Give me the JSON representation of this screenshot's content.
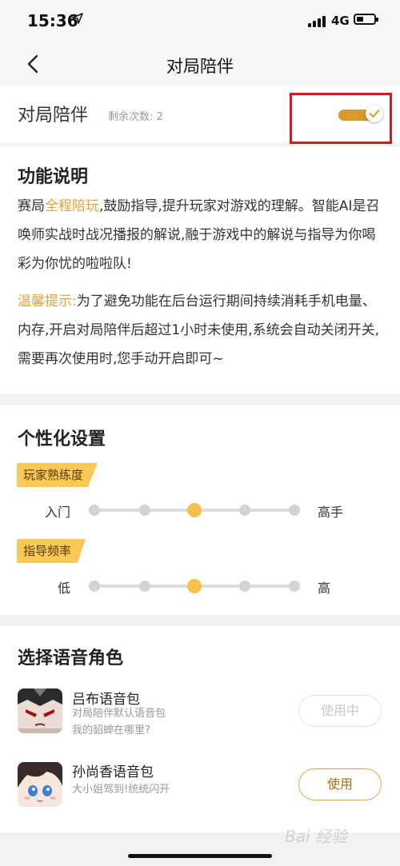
{
  "status_bar": {
    "time": "15:36",
    "network": "4G",
    "icons": [
      "location-arrow-icon",
      "signal-icon",
      "battery-icon"
    ]
  },
  "nav": {
    "title": "对局陪伴",
    "back_icon": "chevron-left-icon"
  },
  "companion_row": {
    "label": "对局陪伴",
    "remaining_label": "剩余次数:",
    "remaining_count": "2",
    "toggle_on": true,
    "accent_color": "#d89a2b",
    "highlight_color": "#d41b1b"
  },
  "function_desc": {
    "title": "功能说明",
    "para1_prefix": "赛局",
    "para1_highlight": "全程陪玩",
    "para1_rest": ",鼓励指导,提升玩家对游戏的理解。智能AI是召唤师实战时战况播报的解说,融于游戏中的解说与指导为你喝彩为你忧的啦啦队!",
    "tip_label": "温馨提示:",
    "tip_text": "为了避免功能在后台运行期间持续消耗手机电量、内存,开启对局陪伴后超过1小时未使用,系统会自动关闭开关,需要再次使用时,您手动开启即可~",
    "highlight_color": "#e6a23c"
  },
  "personalization": {
    "title": "个性化设置",
    "settings": [
      {
        "tag": "玩家熟练度",
        "min_label": "入门",
        "max_label": "高手",
        "steps": 5,
        "selected_index": 2
      },
      {
        "tag": "指导频率",
        "min_label": "低",
        "max_label": "高",
        "steps": 5,
        "selected_index": 2
      }
    ]
  },
  "voice": {
    "title": "选择语音角色",
    "packs": [
      {
        "name": "吕布语音包",
        "desc1": "对局陪伴默认语音包",
        "desc2": "我的貂蝉在哪里?",
        "button": "使用中",
        "in_use": true,
        "avatar_icon": "lubu-avatar"
      },
      {
        "name": "孙尚香语音包",
        "desc1": "大小姐驾到!统统闪开",
        "desc2": "",
        "button": "使用",
        "in_use": false,
        "avatar_icon": "sunshangxiang-avatar"
      }
    ]
  },
  "watermark": "Bai 经验"
}
